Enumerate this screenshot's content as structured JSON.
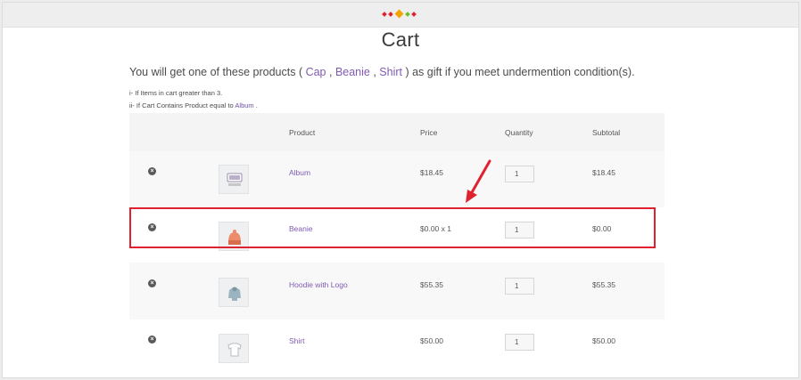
{
  "page": {
    "title": "Cart"
  },
  "gift": {
    "before": "You will get one of these products ( ",
    "item1": "Cap",
    "sep1": " , ",
    "item2": "Beanie",
    "sep2": " , ",
    "item3": "Shirt",
    "after": " ) as gift if you meet undermention condition(s)."
  },
  "conditions": {
    "c1": "i- If Items in cart greater than 3.",
    "c2_prefix": "ii- If Cart Contains Product equal to ",
    "c2_link": "Album",
    "c2_suffix": " ."
  },
  "table": {
    "headers": {
      "product": "Product",
      "price": "Price",
      "quantity": "Quantity",
      "subtotal": "Subtotal"
    },
    "rows": [
      {
        "icon": "album-thumbnail",
        "name": "Album",
        "price": "$18.45",
        "qty": "1",
        "subtotal": "$18.45"
      },
      {
        "icon": "beanie-thumbnail",
        "name": "Beanie",
        "price": "$0.00 x 1",
        "qty": "1",
        "subtotal": "$0.00"
      },
      {
        "icon": "hoodie-thumbnail",
        "name": "Hoodie with Logo",
        "price": "$55.35",
        "qty": "1",
        "subtotal": "$55.35"
      },
      {
        "icon": "shirt-thumbnail",
        "name": "Shirt",
        "price": "$50.00",
        "qty": "1",
        "subtotal": "$50.00"
      }
    ]
  },
  "colors": {
    "link": "#7f5ab3",
    "highlight": "#e0212f",
    "accent_diamonds": [
      "#e0212f",
      "#f2a500",
      "#6cbf2a"
    ]
  },
  "icons": {
    "remove": "remove-x-icon",
    "arrow": "red-annotation-arrow"
  }
}
